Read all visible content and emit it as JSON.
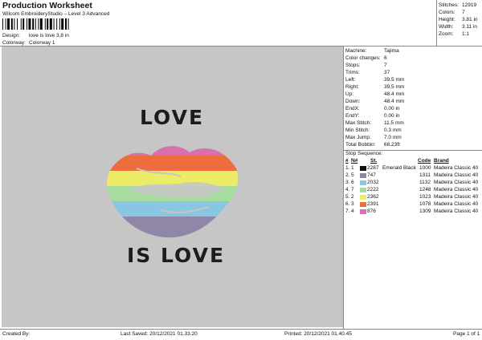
{
  "header": {
    "title": "Production Worksheet",
    "subtitle": "Wilcom EmbroideryStudio – Level 3 Advanced",
    "design_label": "Design:",
    "design_value": "love is love 3,8 in",
    "colorway_label": "Colorway:",
    "colorway_value": "Colorway 1"
  },
  "stats": [
    {
      "label": "Stitches:",
      "value": "12919"
    },
    {
      "label": "Colors:",
      "value": "7"
    },
    {
      "label": "Height:",
      "value": "3.81 in"
    },
    {
      "label": "Width:",
      "value": "3.11 in"
    },
    {
      "label": "Zoom:",
      "value": "1:1"
    }
  ],
  "design": {
    "top_text": "LOVE",
    "bottom_text": "IS LOVE"
  },
  "machine_info": [
    {
      "label": "Machine:",
      "value": "Tajima"
    },
    {
      "label": "Color changes:",
      "value": "6"
    },
    {
      "label": "Stops:",
      "value": "7"
    },
    {
      "label": "Trims:",
      "value": "37"
    },
    {
      "label": "Left:",
      "value": "39.5 mm"
    },
    {
      "label": "Right:",
      "value": "39.5 mm"
    },
    {
      "label": "Up:",
      "value": "48.4 mm"
    },
    {
      "label": "Down:",
      "value": "48.4 mm"
    },
    {
      "label": "EndX:",
      "value": "0.00 in"
    },
    {
      "label": "EndY:",
      "value": "0.00 in"
    },
    {
      "label": "Max Stitch:",
      "value": "11.5 mm"
    },
    {
      "label": "Min Stitch:",
      "value": "0.3 mm"
    },
    {
      "label": "Max Jump:",
      "value": "7.0 mm"
    },
    {
      "label": "Total Bobbin:",
      "value": "68.23ft"
    }
  ],
  "stop_sequence": {
    "title": "Stop Sequence:",
    "headers": {
      "hash": "#",
      "n": "N#",
      "st": "St.",
      "code": "Code",
      "brand": "Brand"
    },
    "rows": [
      {
        "num": "1.",
        "n": "1",
        "color": "#111111",
        "st": "2287",
        "name": "Emerald Black",
        "code": "1000",
        "brand": "Madeira Classic 40"
      },
      {
        "num": "2.",
        "n": "5",
        "color": "#8f86a8",
        "st": "747",
        "name": "",
        "code": "1311",
        "brand": "Madeira Classic 40"
      },
      {
        "num": "3.",
        "n": "6",
        "color": "#89c6e2",
        "st": "2032",
        "name": "",
        "code": "1132",
        "brand": "Madeira Classic 40"
      },
      {
        "num": "4.",
        "n": "7",
        "color": "#a6dc9e",
        "st": "2222",
        "name": "",
        "code": "1248",
        "brand": "Madeira Classic 40"
      },
      {
        "num": "5.",
        "n": "2",
        "color": "#ecec66",
        "st": "2362",
        "name": "",
        "code": "1023",
        "brand": "Madeira Classic 40"
      },
      {
        "num": "6.",
        "n": "3",
        "color": "#ee6d3c",
        "st": "2391",
        "name": "",
        "code": "1078",
        "brand": "Madeira Classic 40"
      },
      {
        "num": "7.",
        "n": "4",
        "color": "#d672b0",
        "st": "876",
        "name": "",
        "code": "1309",
        "brand": "Madeira Classic 40"
      }
    ]
  },
  "footer": {
    "created_by": "Created By:",
    "last_saved": "Last Saved: 20/12/2021 01.33.20",
    "printed": "Printed: 20/12/2021 01.40.45",
    "page": "Page 1 of 1"
  }
}
